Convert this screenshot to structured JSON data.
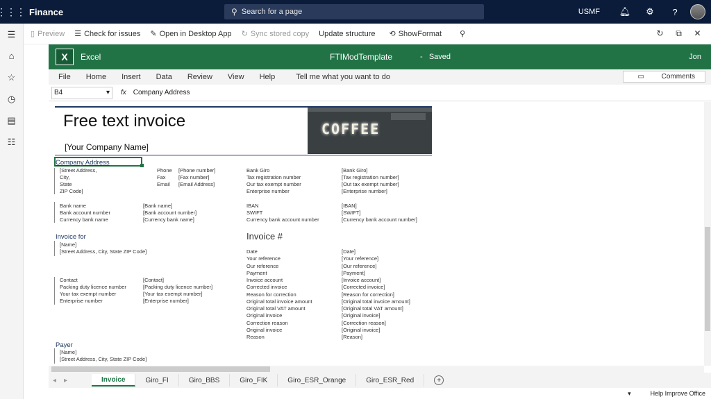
{
  "topbar": {
    "app_name": "Finance",
    "search_placeholder": "Search for a page",
    "company": "USMF"
  },
  "actionbar": {
    "preview": "Preview",
    "check": "Check for issues",
    "open_desktop": "Open in Desktop App",
    "sync": "Sync stored copy",
    "update": "Update structure",
    "showformat": "ShowFormat"
  },
  "excel": {
    "app": "Excel",
    "file": "FTIModTemplate",
    "sep": "-",
    "status": "Saved",
    "user": "Jon"
  },
  "ribbon": {
    "tabs": [
      "File",
      "Home",
      "Insert",
      "Data",
      "Review",
      "View",
      "Help"
    ],
    "tell": "Tell me what you want to do",
    "comments": "Comments"
  },
  "formula": {
    "cell": "B4",
    "fx": "fx",
    "value": "Company Address"
  },
  "sheet": {
    "title": "Free text invoice",
    "company_name": "[Your Company Name]",
    "coffee_sign": "COFFEE",
    "company_address": "Company Address",
    "address_lines": [
      "[Street Address,",
      "City,",
      "State",
      "ZIP Code]"
    ],
    "contact_labels": [
      "Phone",
      "Fax",
      "Email"
    ],
    "contact_values": [
      "[Phone number]",
      "[Fax number]",
      "[Email Address]"
    ],
    "giro_labels": [
      "Bank Giro",
      "Tax registration number",
      "Our tax exempt number",
      "Enterprise number"
    ],
    "giro_values": [
      "[Bank Giro]",
      "[Tax registration number]",
      "[Out tax exempt number]",
      "[Enterprise number]"
    ],
    "bank_labels": [
      "Bank name",
      "Bank account number",
      "Currency bank name"
    ],
    "bank_values": [
      "[Bank name]",
      "[Bank account number]",
      "[Currency bank name]"
    ],
    "iban_labels": [
      "IBAN",
      "SWIFT",
      "Currency bank account number"
    ],
    "iban_values": [
      "[IBAN]",
      "[SWIFT]",
      "[Currency bank account number]"
    ],
    "invoice_for": "Invoice for",
    "invoice_for_lines": [
      "[Name]",
      "[Street Address, City, State ZIP Code]"
    ],
    "invoice_hash": "Invoice #",
    "inv_labels": [
      "Date",
      "Your reference",
      "Our reference",
      "Payment",
      "Invoice account",
      "Corrected invoice",
      "Reason for correction",
      "Original total invoice amount",
      "Original total VAT amount",
      "Original invoice",
      "Correction reason",
      "Original invoice",
      "Reason"
    ],
    "inv_values": [
      "[Date]",
      "[Your reference]",
      "[Our reference]",
      "[Payment]",
      "[Invoice account]",
      "[Corrected invoice]",
      "[Reason for correction]",
      "[Original total invoice amount]",
      "[Original total VAT amount]",
      "[Original invoice]",
      "[Correction reason]",
      "[Original invoice]",
      "[Reason]"
    ],
    "contact2_labels": [
      "Contact",
      "Packing duty licence number",
      "Your tax exempt number",
      "Enterprise number"
    ],
    "contact2_values": [
      "[Contact]",
      "[Packing duty licence number]",
      "[Your tax exempt number]",
      "[Enterprise number]"
    ],
    "payer": "Payer",
    "payer_lines": [
      "[Name]",
      "[Street Address, City, State ZIP Code]"
    ]
  },
  "tabs": [
    "Invoice",
    "Giro_FI",
    "Giro_BBS",
    "Giro_FIK",
    "Giro_ESR_Orange",
    "Giro_ESR_Red"
  ],
  "status": {
    "help": "Help Improve Office"
  }
}
